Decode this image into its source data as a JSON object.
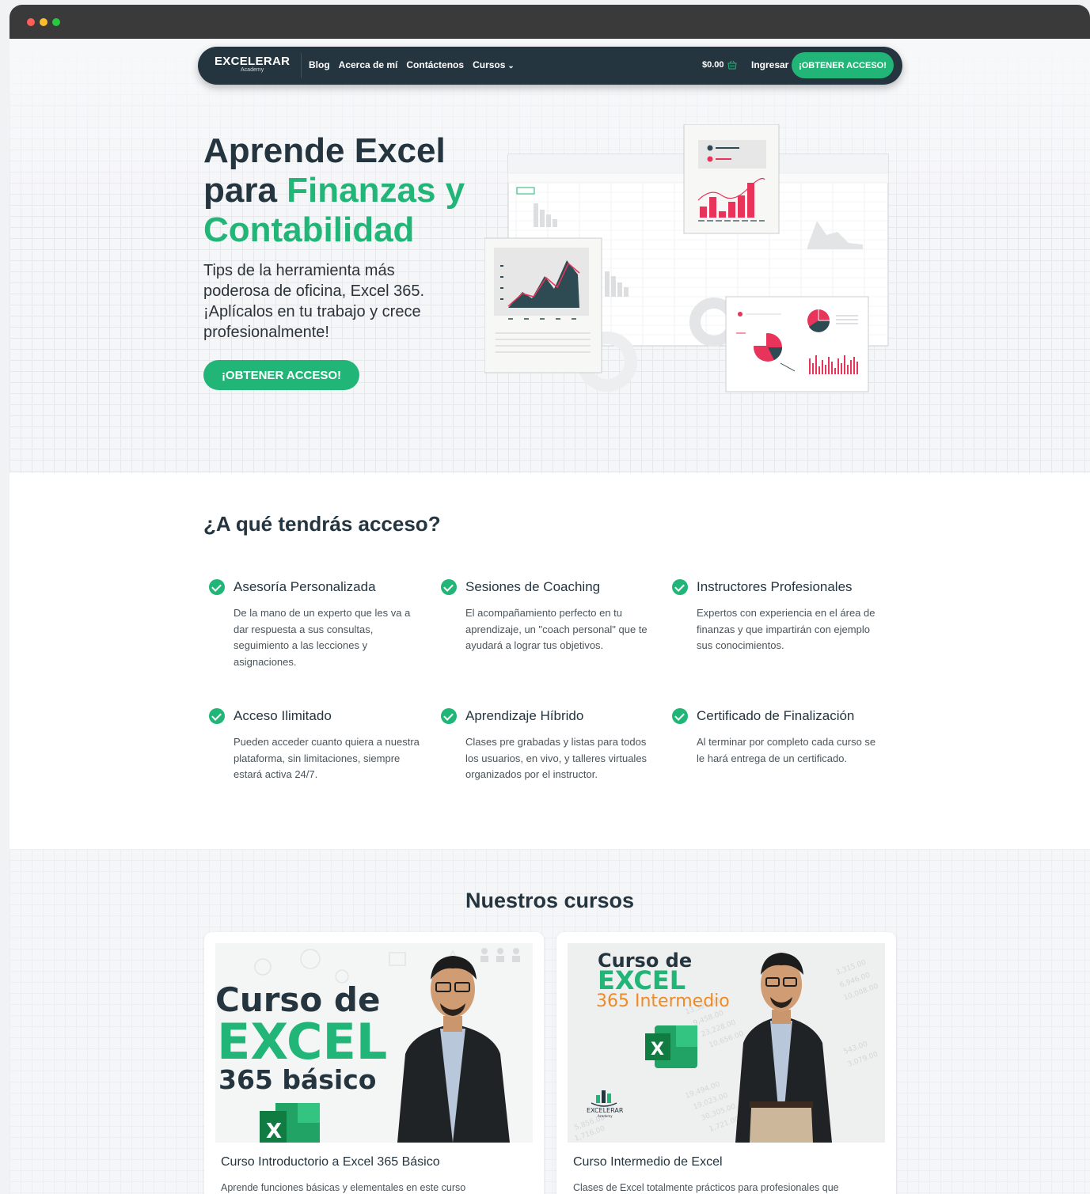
{
  "window": {
    "controls": [
      "close",
      "minimize",
      "maximize"
    ]
  },
  "nav": {
    "logo": "EXCELERAR",
    "logo_sub": "Academy",
    "links": [
      "Blog",
      "Acerca de mí",
      "Contáctenos",
      "Cursos"
    ],
    "cart_total": "$0.00",
    "login": "Ingresar",
    "cta": "¡OBTENER ACCESO!"
  },
  "hero": {
    "title_line1": "Aprende Excel",
    "title_line2_a": "para ",
    "title_line2_b": "Finanzas y",
    "title_line3": "Contabilidad",
    "subtitle": "Tips de la herramienta más poderosa de oficina, Excel 365. ¡Aplícalos en tu trabajo y crece profesionalmente!",
    "cta": "¡OBTENER ACCESO!"
  },
  "access": {
    "title": "¿A qué tendrás acceso?",
    "features": [
      {
        "title": "Asesoría Personalizada",
        "desc": "De la mano de un experto que les va a dar respuesta a sus consultas, seguimiento a las lecciones y asignaciones."
      },
      {
        "title": "Sesiones de Coaching",
        "desc": "El acompañamiento perfecto en tu aprendizaje, un \"coach personal\" que te ayudará a lograr tus objetivos."
      },
      {
        "title": "Instructores Profesionales",
        "desc": "Expertos con experiencia en el área de finanzas y que impartirán con ejemplo sus conocimientos."
      },
      {
        "title": "Acceso Ilimitado",
        "desc": "Pueden acceder cuanto quiera a nuestra plataforma, sin limitaciones, siempre estará activa 24/7."
      },
      {
        "title": "Aprendizaje Híbrido",
        "desc": "Clases pre grabadas y listas para todos los usuarios, en vivo, y talleres virtuales organizados por el instructor."
      },
      {
        "title": "Certificado de Finalización",
        "desc": "Al terminar por completo cada curso se le hará entrega de un certificado."
      }
    ]
  },
  "courses": {
    "title": "Nuestros cursos",
    "items": [
      {
        "image_text": [
          "Curso de",
          "EXCEL",
          "365 básico"
        ],
        "title": "Curso Introductorio a Excel 365 Básico",
        "desc": "Aprende funciones básicas y elementales en este curso"
      },
      {
        "image_text": [
          "Curso de",
          "EXCEL",
          "365 Intermedio"
        ],
        "image_logo": "EXCELERAR",
        "image_logo_sub": "Academy",
        "title": "Curso Intermedio de Excel",
        "desc": "Clases de Excel totalmente prácticos para profesionales que"
      }
    ]
  },
  "colors": {
    "brand_green": "#22b578",
    "navy": "#253540",
    "accent_red": "#e8345a",
    "orange": "#f08a24"
  }
}
